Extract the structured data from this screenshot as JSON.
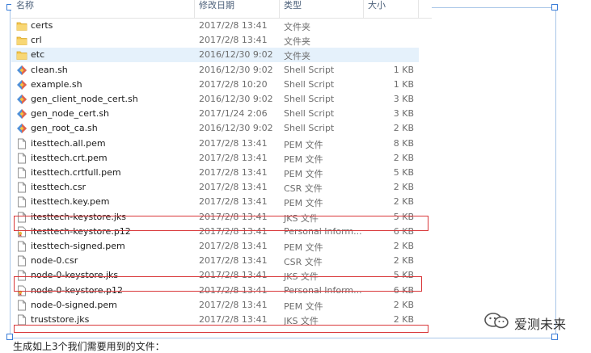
{
  "columns": {
    "name": "名称",
    "date": "修改日期",
    "type": "类型",
    "size": "大小"
  },
  "files": [
    {
      "name": "certs",
      "date": "2017/2/8 13:41",
      "type": "文件夹",
      "size": "",
      "icon": "folder-icon"
    },
    {
      "name": "crl",
      "date": "2017/2/8 13:41",
      "type": "文件夹",
      "size": "",
      "icon": "folder-icon"
    },
    {
      "name": "etc",
      "date": "2016/12/30 9:02",
      "type": "文件夹",
      "size": "",
      "icon": "folder-icon",
      "selected": true
    },
    {
      "name": "clean.sh",
      "date": "2016/12/30 9:02",
      "type": "Shell Script",
      "size": "1 KB",
      "icon": "shell-script-icon"
    },
    {
      "name": "example.sh",
      "date": "2017/2/8 10:20",
      "type": "Shell Script",
      "size": "1 KB",
      "icon": "shell-script-icon"
    },
    {
      "name": "gen_client_node_cert.sh",
      "date": "2016/12/30 9:02",
      "type": "Shell Script",
      "size": "3 KB",
      "icon": "shell-script-icon"
    },
    {
      "name": "gen_node_cert.sh",
      "date": "2017/1/24 2:06",
      "type": "Shell Script",
      "size": "3 KB",
      "icon": "shell-script-icon"
    },
    {
      "name": "gen_root_ca.sh",
      "date": "2016/12/30 9:02",
      "type": "Shell Script",
      "size": "2 KB",
      "icon": "shell-script-icon"
    },
    {
      "name": "itesttech.all.pem",
      "date": "2017/2/8 13:41",
      "type": "PEM 文件",
      "size": "8 KB",
      "icon": "file-icon"
    },
    {
      "name": "itesttech.crt.pem",
      "date": "2017/2/8 13:41",
      "type": "PEM 文件",
      "size": "2 KB",
      "icon": "file-icon"
    },
    {
      "name": "itesttech.crtfull.pem",
      "date": "2017/2/8 13:41",
      "type": "PEM 文件",
      "size": "5 KB",
      "icon": "file-icon"
    },
    {
      "name": "itesttech.csr",
      "date": "2017/2/8 13:41",
      "type": "CSR 文件",
      "size": "2 KB",
      "icon": "file-icon"
    },
    {
      "name": "itesttech.key.pem",
      "date": "2017/2/8 13:41",
      "type": "PEM 文件",
      "size": "2 KB",
      "icon": "file-icon"
    },
    {
      "name": "itesttech-keystore.jks",
      "date": "2017/2/8 13:41",
      "type": "JKS 文件",
      "size": "5 KB",
      "icon": "file-icon",
      "highlighted": true
    },
    {
      "name": "itesttech-keystore.p12",
      "date": "2017/2/8 13:41",
      "type": "Personal Inform...",
      "size": "6 KB",
      "icon": "certificate-icon"
    },
    {
      "name": "itesttech-signed.pem",
      "date": "2017/2/8 13:41",
      "type": "PEM 文件",
      "size": "2 KB",
      "icon": "file-icon"
    },
    {
      "name": "node-0.csr",
      "date": "2017/2/8 13:41",
      "type": "CSR 文件",
      "size": "2 KB",
      "icon": "file-icon"
    },
    {
      "name": "node-0-keystore.jks",
      "date": "2017/2/8 13:41",
      "type": "JKS 文件",
      "size": "5 KB",
      "icon": "file-icon",
      "highlighted": true
    },
    {
      "name": "node-0-keystore.p12",
      "date": "2017/2/8 13:41",
      "type": "Personal Inform...",
      "size": "6 KB",
      "icon": "certificate-icon"
    },
    {
      "name": "node-0-signed.pem",
      "date": "2017/2/8 13:41",
      "type": "PEM 文件",
      "size": "2 KB",
      "icon": "file-icon"
    },
    {
      "name": "truststore.jks",
      "date": "2017/2/8 13:41",
      "type": "JKS 文件",
      "size": "2 KB",
      "icon": "file-icon",
      "highlighted": true
    }
  ],
  "watermark": {
    "text": "爱测未来",
    "icon": "wechat-icon"
  },
  "caption": "生成如上3个我们需要用到的文件："
}
